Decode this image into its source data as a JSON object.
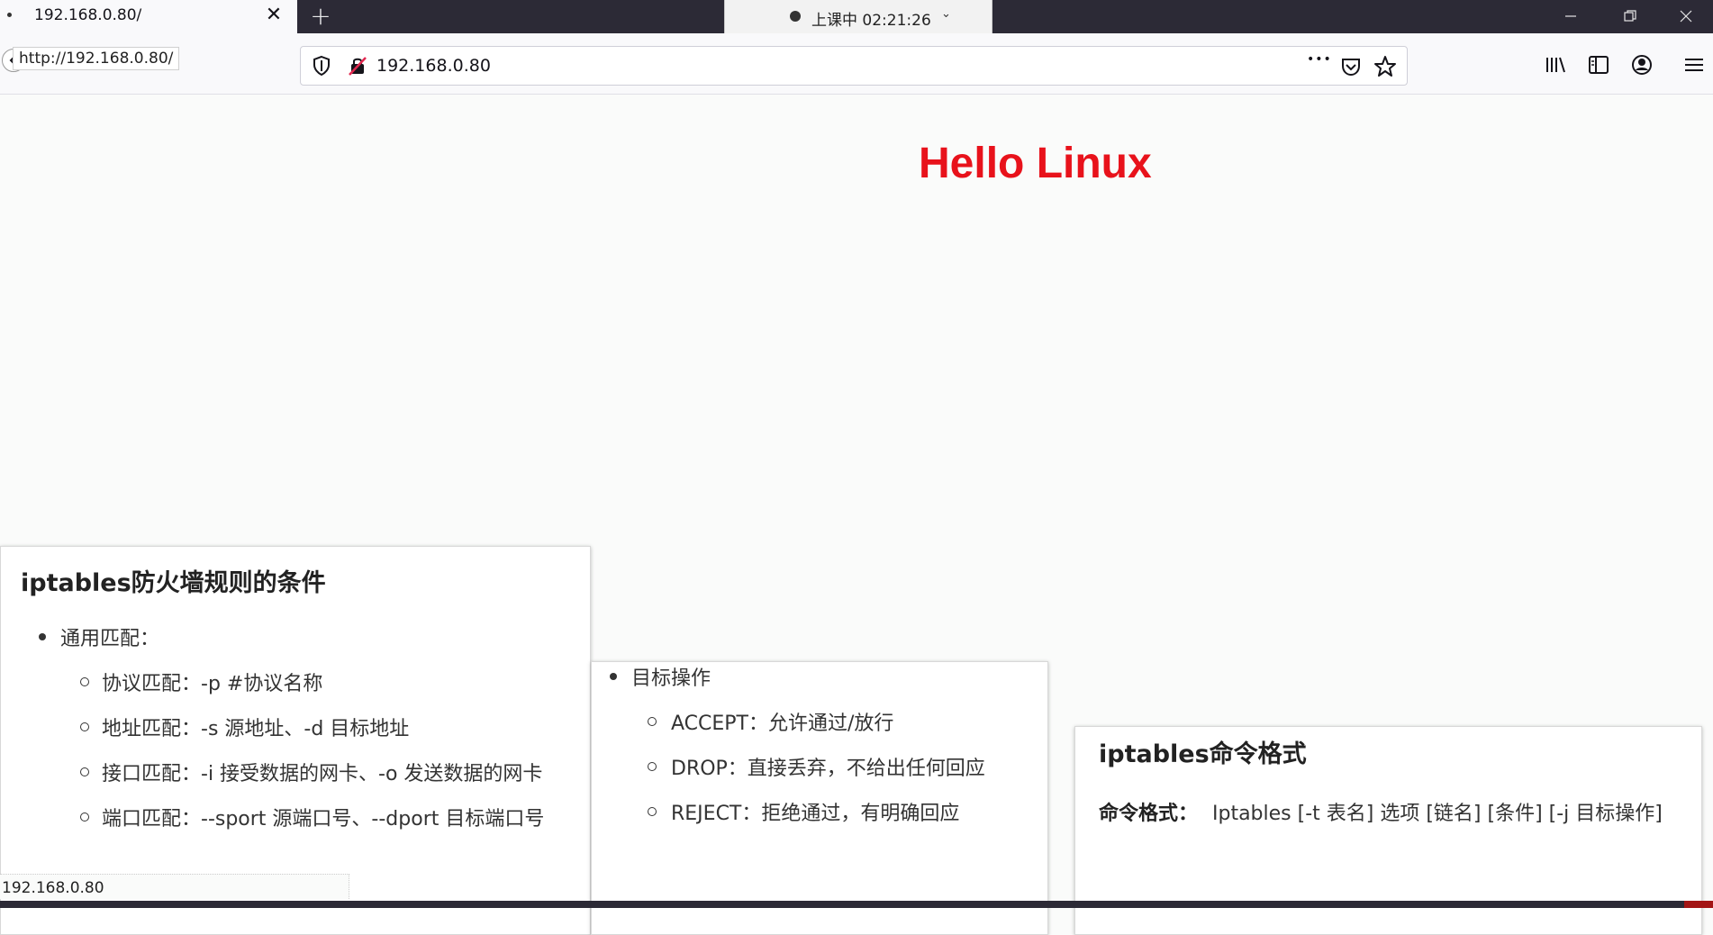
{
  "browser": {
    "tab_title": "192.168.0.80/",
    "new_tab_symbol": "+",
    "close_symbol": "✕",
    "url": "192.168.0.80",
    "hover_url": "http://192.168.0.80/",
    "status_url": "192.168.0.80",
    "more_symbol": "•••"
  },
  "recording": {
    "label": "上课中 02:21:26",
    "chevron": "⌄"
  },
  "page": {
    "heading": "Hello Linux",
    "heading_color": "#e8121b"
  },
  "card_conditions": {
    "title": "iptables防火墙规则的条件",
    "item": "通用匹配：",
    "subitems": [
      "协议匹配：-p   #协议名称",
      "地址匹配：-s 源地址、-d 目标地址",
      "接口匹配：-i  接受数据的网卡、-o 发送数据的网卡",
      "端口匹配：--sport 源端口号、--dport 目标端口号"
    ]
  },
  "card_targets": {
    "item": "目标操作",
    "subitems": [
      "ACCEPT：允许通过/放行",
      "DROP：直接丢弃，不给出任何回应",
      "REJECT：拒绝通过，有明确回应"
    ]
  },
  "card_format": {
    "title": "iptables命令格式",
    "label": "命令格式：",
    "value": "Iptables [-t 表名] 选项 [链名] [条件] [-j 目标操作]"
  }
}
